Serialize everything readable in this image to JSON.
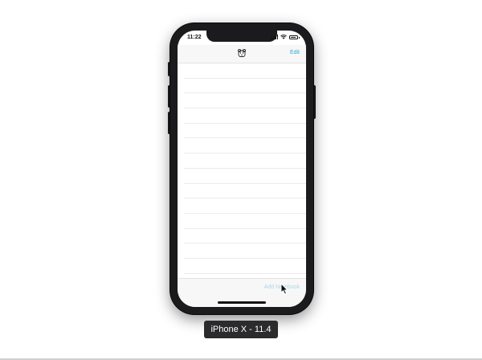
{
  "status_bar": {
    "time": "11:22"
  },
  "nav_bar": {
    "logo_icon": "app-logo-icon",
    "edit_label": "Edit"
  },
  "table": {
    "rows": [
      "",
      "",
      "",
      "",
      "",
      "",
      "",
      "",
      "",
      "",
      "",
      "",
      "",
      ""
    ]
  },
  "toolbar": {
    "add_label": "Add Notebook"
  },
  "simulator": {
    "device_label": "iPhone X - 11.4"
  },
  "colors": {
    "accent": "#2fa9d9",
    "accent_disabled": "#a9d9ee",
    "device_frame": "#1b1b1d"
  }
}
